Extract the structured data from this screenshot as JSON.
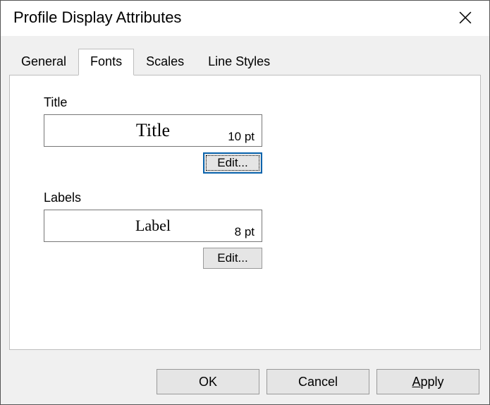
{
  "window": {
    "title": "Profile Display Attributes"
  },
  "tabs": {
    "general": "General",
    "fonts": "Fonts",
    "scales": "Scales",
    "lineStyles": "Line Styles"
  },
  "fontsPage": {
    "titleSection": {
      "label": "Title",
      "previewText": "Title",
      "size": "10 pt",
      "editLabel": "Edit..."
    },
    "labelsSection": {
      "label": "Labels",
      "previewText": "Label",
      "size": "8 pt",
      "editLabel": "Edit..."
    }
  },
  "buttons": {
    "ok": "OK",
    "cancel": "Cancel",
    "applyPrefix": "A",
    "applyRest": "pply"
  }
}
